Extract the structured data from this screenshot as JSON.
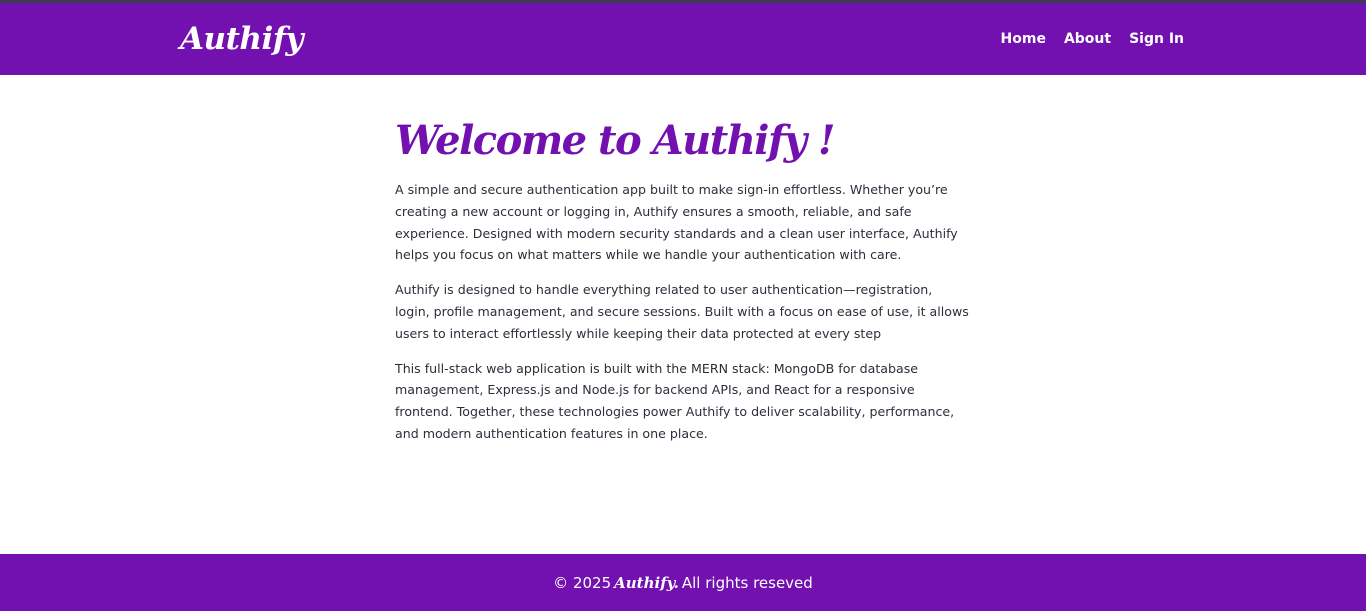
{
  "navbar": {
    "brand": "Authify",
    "links": [
      "Home",
      "About",
      "Sign In"
    ]
  },
  "main": {
    "heading": "Welcome to Authify !",
    "paragraphs": [
      "A simple and secure authentication app built to make sign-in effortless. Whether you’re creating a new account or logging in, Authify ensures a smooth, reliable, and safe experience. Designed with modern security standards and a clean user interface, Authify helps you focus on what matters while we handle your authentication with care.",
      "Authify is designed to handle everything related to user authentication—registration, login, profile management, and secure sessions. Built with a focus on ease of use, it allows users to interact effortlessly while keeping their data protected at every step",
      "This full-stack web application is built with the MERN stack: MongoDB for database management, Express.js and Node.js for backend APIs, and React for a responsive frontend. Together, these technologies power Authify to deliver scalability, performance, and modern authentication features in one place."
    ]
  },
  "footer": {
    "prefix": "© 2025",
    "brand": "Authify.",
    "suffix": "All rights reseved"
  },
  "colors": {
    "brand_purple": "#7210b0",
    "top_strip": "#3b3a4e",
    "body_text": "#2b2f3a",
    "background": "#ffffff"
  }
}
